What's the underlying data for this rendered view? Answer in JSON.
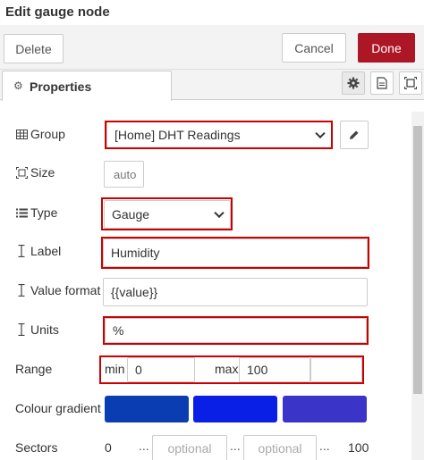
{
  "window": {
    "title": "Edit gauge node"
  },
  "toolbar": {
    "delete_label": "Delete",
    "cancel_label": "Cancel",
    "done_label": "Done"
  },
  "tabs": {
    "properties_label": "Properties"
  },
  "form": {
    "group": {
      "label": "Group",
      "value": "[Home] DHT Readings"
    },
    "size": {
      "label": "Size",
      "value": "auto"
    },
    "type": {
      "label": "Type",
      "value": "Gauge"
    },
    "label": {
      "label": "Label",
      "value": "Humidity"
    },
    "value_format": {
      "label": "Value format",
      "value": "{{value}}"
    },
    "units": {
      "label": "Units",
      "value": "%"
    },
    "range": {
      "label": "Range",
      "min_label": "min",
      "min_value": "0",
      "max_label": "max",
      "max_value": "100"
    },
    "colour_gradient": {
      "label": "Colour gradient",
      "colors": [
        "#0a3db2",
        "#0a1fe6",
        "#3a35c8"
      ]
    },
    "sectors": {
      "label": "Sectors",
      "start": "0",
      "sep1": "...",
      "placeholder1": "optional",
      "sep2": "...",
      "placeholder2": "optional",
      "sep3": "...",
      "end": "100"
    }
  },
  "colors": {
    "done_button": "#ad1625",
    "highlight": "#cc0000"
  }
}
